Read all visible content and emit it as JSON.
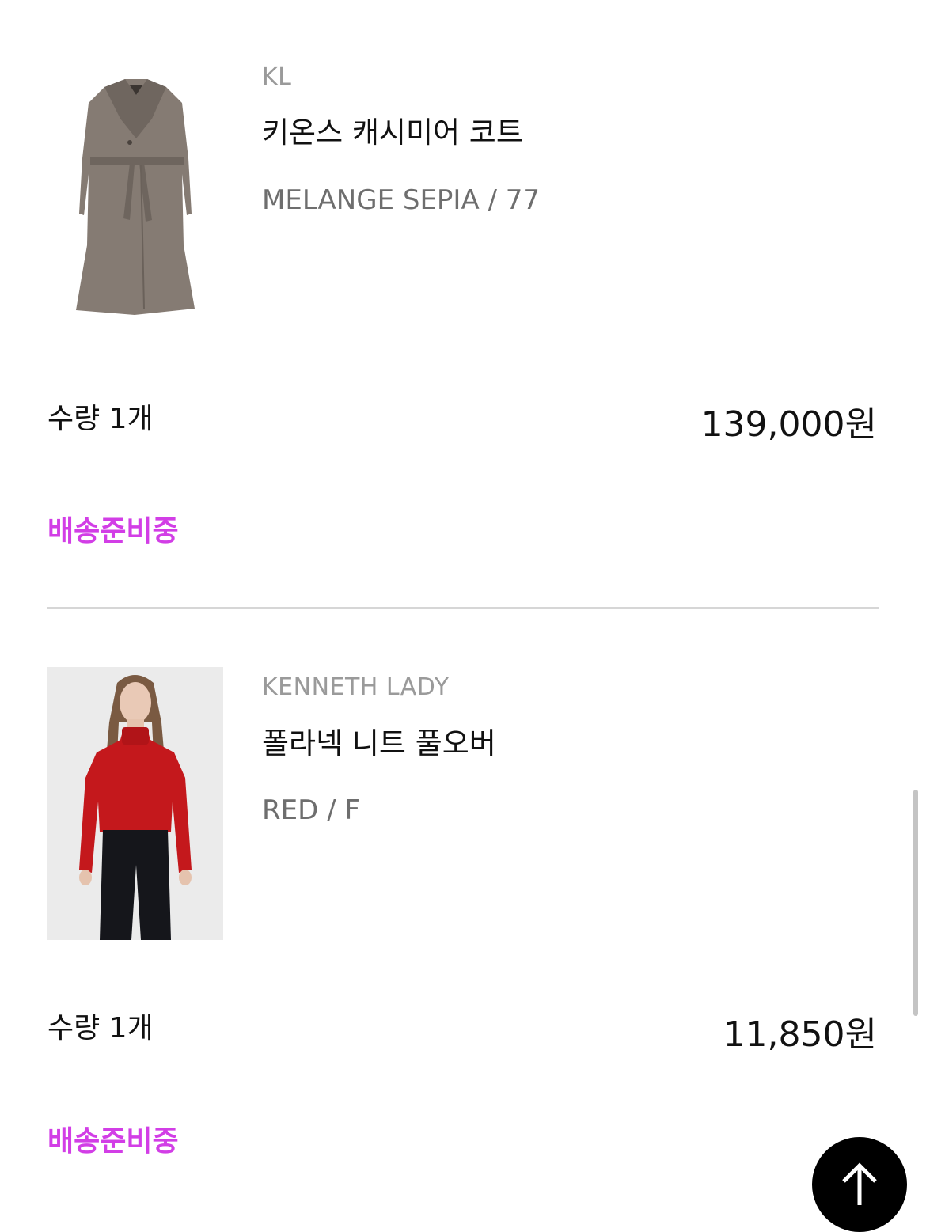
{
  "colors": {
    "status": "#d23ee6",
    "divider": "#d6d6d6",
    "brand_text": "#9a9a9a",
    "option_text": "#6e6e6e"
  },
  "orders": [
    {
      "brand": "KL",
      "name": "키온스 캐시미어 코트",
      "option": "MELANGE SEPIA / 77",
      "quantity": "수량 1개",
      "price": "139,000원",
      "status": "배송준비중",
      "image_icon": "coat-product-image"
    },
    {
      "brand": "KENNETH LADY",
      "name": "폴라넥 니트 풀오버",
      "option": "RED / F",
      "quantity": "수량 1개",
      "price": "11,850원",
      "status": "배송준비중",
      "image_icon": "red-knit-product-image"
    }
  ],
  "scroll_top_icon": "arrow-up-icon"
}
